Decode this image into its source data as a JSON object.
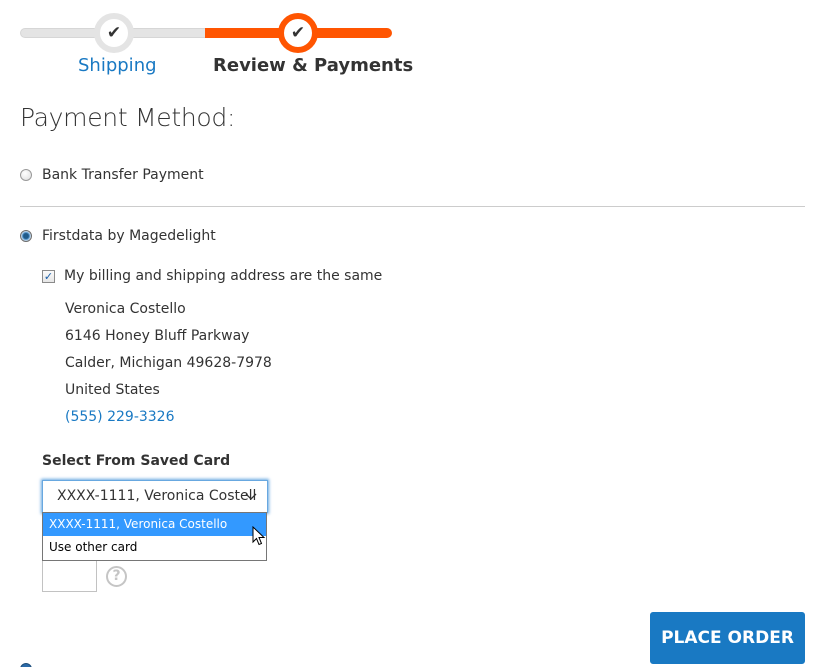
{
  "progress": {
    "steps": [
      {
        "label": "Shipping",
        "state": "complete",
        "icon": "check-icon"
      },
      {
        "label": "Review & Payments",
        "state": "active",
        "icon": "check-icon"
      }
    ],
    "check_glyph": "✔"
  },
  "colors": {
    "accent": "#ff5501",
    "link": "#1979c3",
    "primary_button": "#1979c3",
    "dropdown_highlight": "#3399ff"
  },
  "page": {
    "title": "Payment Method:"
  },
  "payment_methods": [
    {
      "label": "Bank Transfer Payment",
      "selected": false
    },
    {
      "label": "Firstdata by Magedelight",
      "selected": true
    }
  ],
  "billing": {
    "same_address_label": "My billing and shipping address are the same",
    "same_address_checked": true,
    "check_glyph": "✓",
    "address": {
      "name": "Veronica Costello",
      "street": "6146 Honey Bluff Parkway",
      "city_line": "Calder, Michigan 49628-7978",
      "country": "United States",
      "phone": "(555) 229-3326"
    }
  },
  "saved_card": {
    "label": "Select From Saved Card",
    "selected_value": "XXXX-1111, Veronica Costell",
    "arrow_glyph": "⌵",
    "options": [
      {
        "label": "XXXX-1111, Veronica Costello",
        "highlighted": true
      },
      {
        "label": "Use other card",
        "highlighted": false
      }
    ]
  },
  "cvv": {
    "value": "",
    "help_glyph": "?"
  },
  "actions": {
    "place_order_label": "PLACE ORDER"
  }
}
